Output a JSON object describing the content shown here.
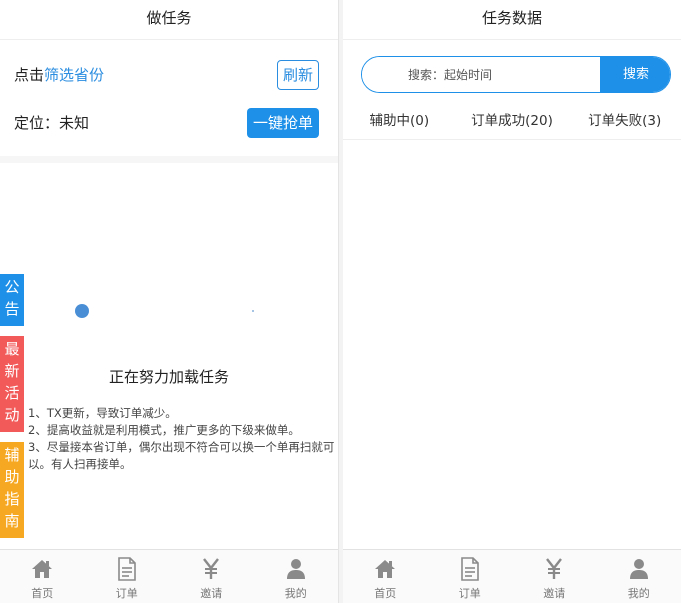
{
  "left": {
    "title": "做任务",
    "click_prefix": "点击",
    "filter_link": "筛选省份",
    "refresh_label": "刷新",
    "location_label": "定位：未知",
    "grab_label": "一键抢单",
    "loading_text": "正在努力加载任务",
    "notes": [
      "1、TX更新，导致订单减少。",
      "2、提高收益就是利用模式，推广更多的下级来做单。",
      "3、尽量接本省订单，偶尔出现不符合可以换一个单再扫就可以。有人扫再接单。"
    ],
    "side_tabs": {
      "notice": [
        "公",
        "告"
      ],
      "activity": [
        "最",
        "新",
        "活",
        "动"
      ],
      "guide": [
        "辅",
        "助",
        "指",
        "南"
      ]
    }
  },
  "right": {
    "title": "任务数据",
    "search_placeholder": "搜索：起始时间",
    "search_button": "搜索",
    "tabs": [
      "辅助中(0)",
      "订单成功(20)",
      "订单失败(3)"
    ]
  },
  "nav": [
    {
      "label": "首页",
      "icon": "home-icon"
    },
    {
      "label": "订单",
      "icon": "document-icon"
    },
    {
      "label": "邀请",
      "icon": "yen-icon"
    },
    {
      "label": "我的",
      "icon": "user-icon"
    }
  ],
  "colors": {
    "accent": "#1e90e8",
    "activity": "#f25a5a",
    "guide": "#f7a823"
  }
}
